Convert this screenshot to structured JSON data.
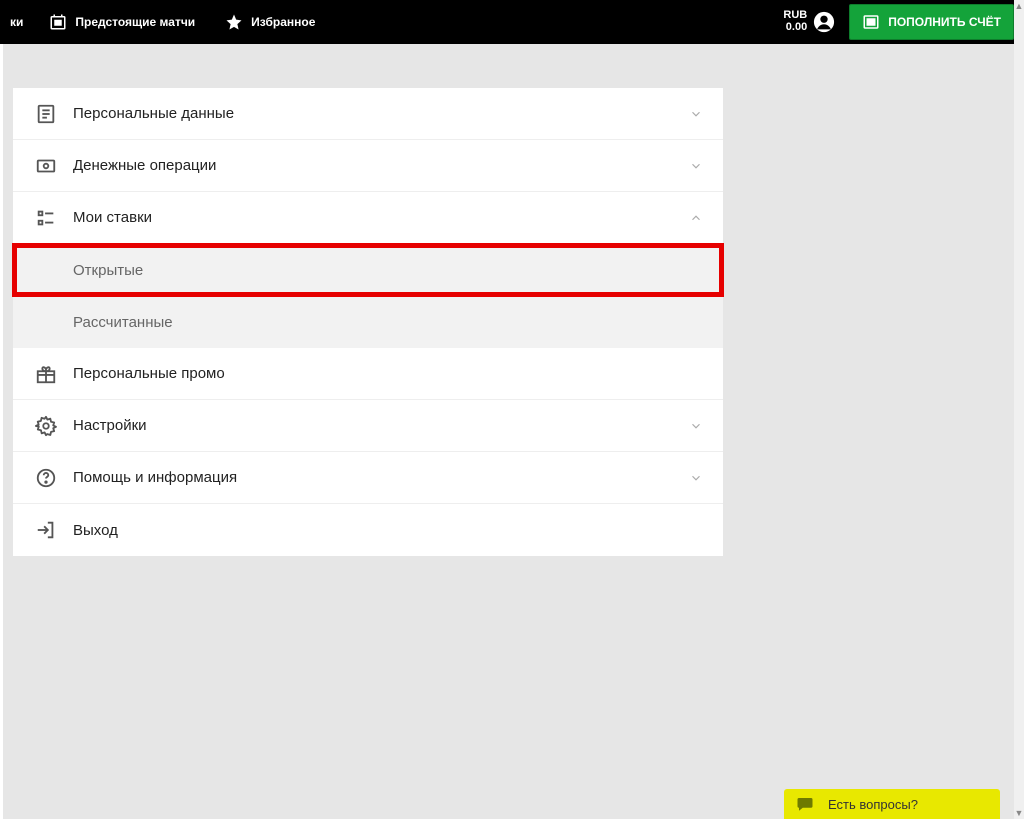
{
  "topbar": {
    "left_fragment": "ки",
    "upcoming": "Предстоящие матчи",
    "favorites": "Избранное",
    "currency": "RUB",
    "balance": "0.00",
    "deposit": "ПОПОЛНИТЬ СЧЁТ"
  },
  "menu": {
    "personal_data": "Персональные данные",
    "money_ops": "Денежные операции",
    "my_bets": "Мои ставки",
    "my_bets_sub": {
      "open": "Открытые",
      "settled": "Рассчитанные"
    },
    "personal_promo": "Персональные промо",
    "settings": "Настройки",
    "help": "Помощь и информация",
    "logout": "Выход"
  },
  "chat": {
    "label": "Есть вопросы?"
  }
}
